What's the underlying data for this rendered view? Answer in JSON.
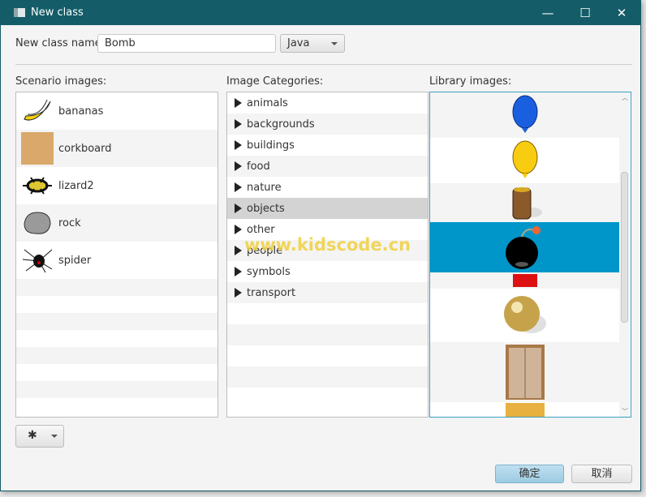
{
  "window": {
    "title": "New class",
    "minimize": "—",
    "maximize": "☐",
    "close": "✕"
  },
  "form": {
    "name_label": "New class name:",
    "name_value": "Bomb",
    "language": "Java"
  },
  "scenario": {
    "label": "Scenario images:",
    "items": [
      {
        "name": "bananas",
        "icon": "banana-icon"
      },
      {
        "name": "corkboard",
        "icon": "corkboard-icon"
      },
      {
        "name": "lizard2",
        "icon": "lizard-icon"
      },
      {
        "name": "rock",
        "icon": "rock-icon"
      },
      {
        "name": "spider",
        "icon": "spider-icon"
      }
    ]
  },
  "categories": {
    "label": "Image Categories:",
    "items": [
      "animals",
      "backgrounds",
      "buildings",
      "food",
      "nature",
      "objects",
      "other",
      "people",
      "symbols",
      "transport"
    ],
    "selected": "objects"
  },
  "library": {
    "label": "Library images:",
    "items": [
      "blue-balloon",
      "yellow-balloon",
      "barrel",
      "bomb",
      "red-brick",
      "gold-ball",
      "elevator-door",
      "gold-door"
    ],
    "selected": "bomb",
    "selected_color": "#0096c9"
  },
  "watermark": "www.kidscode.cn",
  "buttons": {
    "ok": "确定",
    "cancel": "取消",
    "settings_icon": "gear-icon"
  }
}
